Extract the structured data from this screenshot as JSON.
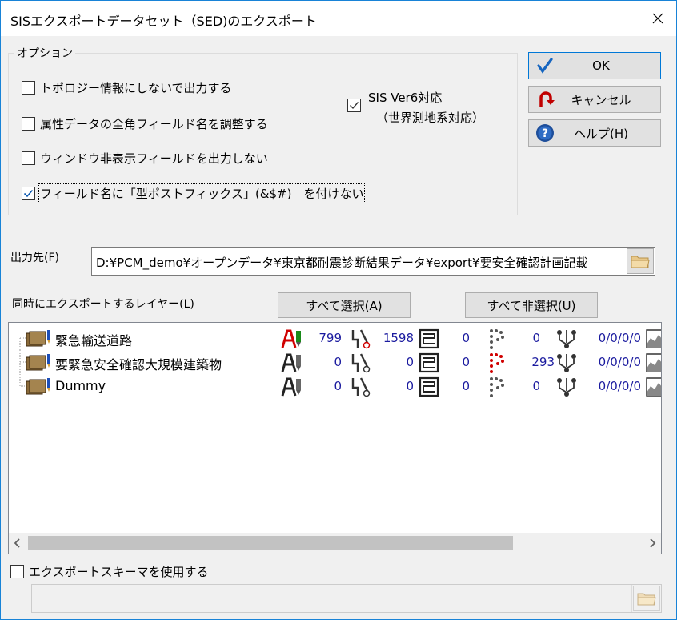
{
  "window": {
    "title": "SISエクスポートデータセット（SED)のエクスポート"
  },
  "options": {
    "legend": "オプション",
    "checkboxes": [
      {
        "label": "トポロジー情報にしないで出力する",
        "checked": false
      },
      {
        "label": "属性データの全角フィールド名を調整する",
        "checked": false
      },
      {
        "label": "ウィンドウ非表示フィールドを出力しない",
        "checked": false
      },
      {
        "label": "フィールド名に「型ポストフィックス」(&$#)　を付けない",
        "checked": true
      }
    ],
    "ver6": {
      "line1": "SIS Ver6対応",
      "line2": "（世界測地系対応）",
      "checked": true
    }
  },
  "buttons": {
    "ok": "OK",
    "cancel": "キャンセル",
    "help": "ヘルプ(H)"
  },
  "output": {
    "label": "出力先(F)",
    "path": "D:¥PCM_demo¥オープンデータ¥東京都耐震診断結果データ¥export¥要安全確認計画記載"
  },
  "layers": {
    "label": "同時にエクスポートするレイヤー(L)",
    "select_all": "すべて選択(A)",
    "deselect_all": "すべて非選択(U)",
    "rows": [
      {
        "name": "緊急輸送道路",
        "text_count": "799",
        "line_count": "1598",
        "area_count": "0",
        "point_count": "0",
        "node_info": "0/0/0/0"
      },
      {
        "name": "要緊急安全確認大規模建築物",
        "text_count": "0",
        "line_count": "0",
        "area_count": "0",
        "point_count": "293",
        "node_info": "0/0/0/0"
      },
      {
        "name": "Dummy",
        "text_count": "0",
        "line_count": "0",
        "area_count": "0",
        "point_count": "0",
        "node_info": "0/0/0/0"
      }
    ]
  },
  "schema": {
    "label": "エクスポートスキーマを使用する",
    "checked": false
  },
  "colors": {
    "accent": "#0078d7",
    "count_text": "#1b1b9f",
    "ok_check": "#1565c0",
    "cancel_icon": "#c00000"
  }
}
